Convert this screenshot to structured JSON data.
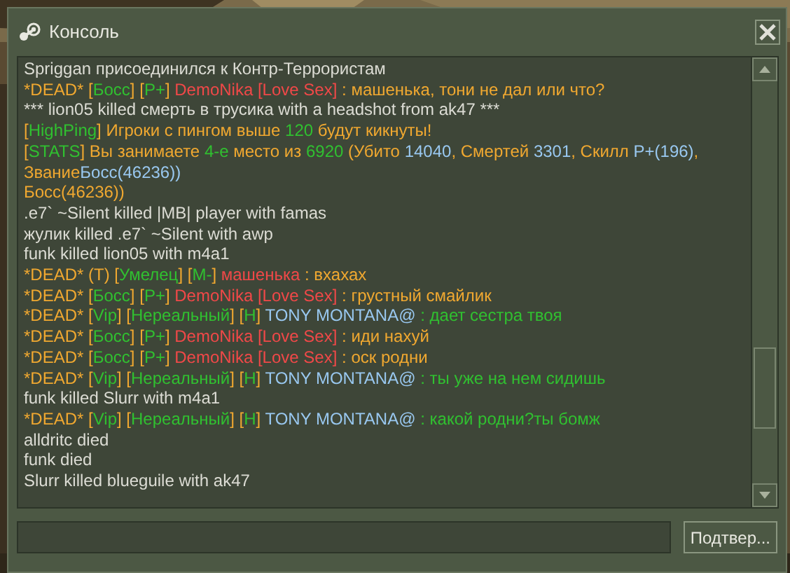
{
  "window": {
    "title": "Консоль"
  },
  "log": [
    {
      "parts": [
        {
          "text": "Spriggan присоединился к Контр-Террористам",
          "color": "#dcdcd4"
        }
      ]
    },
    {
      "parts": [
        {
          "text": "*DEAD* [",
          "color": "#f0a830"
        },
        {
          "text": "Босс",
          "color": "#30c030"
        },
        {
          "text": "] [",
          "color": "#f0a830"
        },
        {
          "text": "P+",
          "color": "#30c030"
        },
        {
          "text": "] ",
          "color": "#f0a830"
        },
        {
          "text": "DemoNika [Love Sex]",
          "color": "#f04848"
        },
        {
          "text": " : машенька, тони не дал или что?",
          "color": "#f0a830"
        }
      ]
    },
    {
      "parts": [
        {
          "text": "*** lion05 killed смерть в трусика with a headshot from ak47 ***",
          "color": "#dcdcd4"
        }
      ]
    },
    {
      "parts": [
        {
          "text": "[",
          "color": "#f0a830"
        },
        {
          "text": "HighPing",
          "color": "#30c030"
        },
        {
          "text": "] Игроки с пингом выше ",
          "color": "#f0a830"
        },
        {
          "text": "120",
          "color": "#30c030"
        },
        {
          "text": " будут кикнуты!",
          "color": "#f0a830"
        }
      ]
    },
    {
      "parts": [
        {
          "text": "[",
          "color": "#f0a830"
        },
        {
          "text": "STATS",
          "color": "#30c030"
        },
        {
          "text": "] Вы занимаете ",
          "color": "#f0a830"
        },
        {
          "text": "4-е",
          "color": "#30c030"
        },
        {
          "text": " место из ",
          "color": "#f0a830"
        },
        {
          "text": "6920",
          "color": "#30c030"
        },
        {
          "text": " (Убито ",
          "color": "#f0a830"
        },
        {
          "text": "14040",
          "color": "#99c8f0"
        },
        {
          "text": ", Смертей ",
          "color": "#f0a830"
        },
        {
          "text": "3301",
          "color": "#99c8f0"
        },
        {
          "text": ", Скилл ",
          "color": "#f0a830"
        },
        {
          "text": "P+(196)",
          "color": "#99c8f0"
        },
        {
          "text": ", Звание",
          "color": "#f0a830"
        },
        {
          "text": "Босс(46236))",
          "color": "#99c8f0"
        }
      ]
    },
    {
      "parts": [
        {
          "text": "Босс(46236))",
          "color": "#f0a830"
        }
      ]
    },
    {
      "parts": [
        {
          "text": ".e7` ~Silent killed |MB| player with famas",
          "color": "#dcdcd4"
        }
      ]
    },
    {
      "parts": [
        {
          "text": "жулик killed .e7` ~Silent with awp",
          "color": "#dcdcd4"
        }
      ]
    },
    {
      "parts": [
        {
          "text": "funk killed lion05 with m4a1",
          "color": "#dcdcd4"
        }
      ]
    },
    {
      "parts": [
        {
          "text": "*DEAD* (T) [",
          "color": "#f0a830"
        },
        {
          "text": "Умелец",
          "color": "#30c030"
        },
        {
          "text": "] [",
          "color": "#f0a830"
        },
        {
          "text": "M-",
          "color": "#30c030"
        },
        {
          "text": "] ",
          "color": "#f0a830"
        },
        {
          "text": "машенька",
          "color": "#f04848"
        },
        {
          "text": " : вхахах",
          "color": "#f0a830"
        }
      ]
    },
    {
      "parts": [
        {
          "text": "*DEAD* [",
          "color": "#f0a830"
        },
        {
          "text": "Босс",
          "color": "#30c030"
        },
        {
          "text": "] [",
          "color": "#f0a830"
        },
        {
          "text": "P+",
          "color": "#30c030"
        },
        {
          "text": "] ",
          "color": "#f0a830"
        },
        {
          "text": "DemoNika [Love Sex]",
          "color": "#f04848"
        },
        {
          "text": " : грустный смайлик",
          "color": "#f0a830"
        }
      ]
    },
    {
      "parts": [
        {
          "text": "*DEAD* [",
          "color": "#f0a830"
        },
        {
          "text": "Vip",
          "color": "#30c030"
        },
        {
          "text": "] [",
          "color": "#f0a830"
        },
        {
          "text": "Нереальный",
          "color": "#30c030"
        },
        {
          "text": "] [",
          "color": "#f0a830"
        },
        {
          "text": "H",
          "color": "#30c030"
        },
        {
          "text": "] ",
          "color": "#f0a830"
        },
        {
          "text": "TONY MONTANA@",
          "color": "#99c8f0"
        },
        {
          "text": " : дает сестра твоя",
          "color": "#30c030"
        }
      ]
    },
    {
      "parts": [
        {
          "text": "*DEAD* [",
          "color": "#f0a830"
        },
        {
          "text": "Босс",
          "color": "#30c030"
        },
        {
          "text": "] [",
          "color": "#f0a830"
        },
        {
          "text": "P+",
          "color": "#30c030"
        },
        {
          "text": "] ",
          "color": "#f0a830"
        },
        {
          "text": "DemoNika [Love Sex]",
          "color": "#f04848"
        },
        {
          "text": " : иди нахуй",
          "color": "#f0a830"
        }
      ]
    },
    {
      "parts": [
        {
          "text": "*DEAD* [",
          "color": "#f0a830"
        },
        {
          "text": "Босс",
          "color": "#30c030"
        },
        {
          "text": "] [",
          "color": "#f0a830"
        },
        {
          "text": "P+",
          "color": "#30c030"
        },
        {
          "text": "] ",
          "color": "#f0a830"
        },
        {
          "text": "DemoNika [Love Sex]",
          "color": "#f04848"
        },
        {
          "text": " : оск родни",
          "color": "#f0a830"
        }
      ]
    },
    {
      "parts": [
        {
          "text": "*DEAD* [",
          "color": "#f0a830"
        },
        {
          "text": "Vip",
          "color": "#30c030"
        },
        {
          "text": "] [",
          "color": "#f0a830"
        },
        {
          "text": "Нереальный",
          "color": "#30c030"
        },
        {
          "text": "] [",
          "color": "#f0a830"
        },
        {
          "text": "H",
          "color": "#30c030"
        },
        {
          "text": "] ",
          "color": "#f0a830"
        },
        {
          "text": "TONY MONTANA@",
          "color": "#99c8f0"
        },
        {
          "text": " : ты уже на нем сидишь",
          "color": "#30c030"
        }
      ]
    },
    {
      "parts": [
        {
          "text": "funk killed Slurr with m4a1",
          "color": "#dcdcd4"
        }
      ]
    },
    {
      "parts": [
        {
          "text": "*DEAD* [",
          "color": "#f0a830"
        },
        {
          "text": "Vip",
          "color": "#30c030"
        },
        {
          "text": "] [",
          "color": "#f0a830"
        },
        {
          "text": "Нереальный",
          "color": "#30c030"
        },
        {
          "text": "] [",
          "color": "#f0a830"
        },
        {
          "text": "H",
          "color": "#30c030"
        },
        {
          "text": "] ",
          "color": "#f0a830"
        },
        {
          "text": "TONY MONTANA@",
          "color": "#99c8f0"
        },
        {
          "text": " : какой родни?ты бомж",
          "color": "#30c030"
        }
      ]
    },
    {
      "parts": [
        {
          "text": "alldritc died",
          "color": "#dcdcd4"
        }
      ]
    },
    {
      "parts": [
        {
          "text": "funk died",
          "color": "#dcdcd4"
        }
      ]
    },
    {
      "parts": [
        {
          "text": "Slurr killed blueguile with ak47",
          "color": "#dcdcd4"
        }
      ]
    }
  ],
  "submit_button": "Подтвер..."
}
